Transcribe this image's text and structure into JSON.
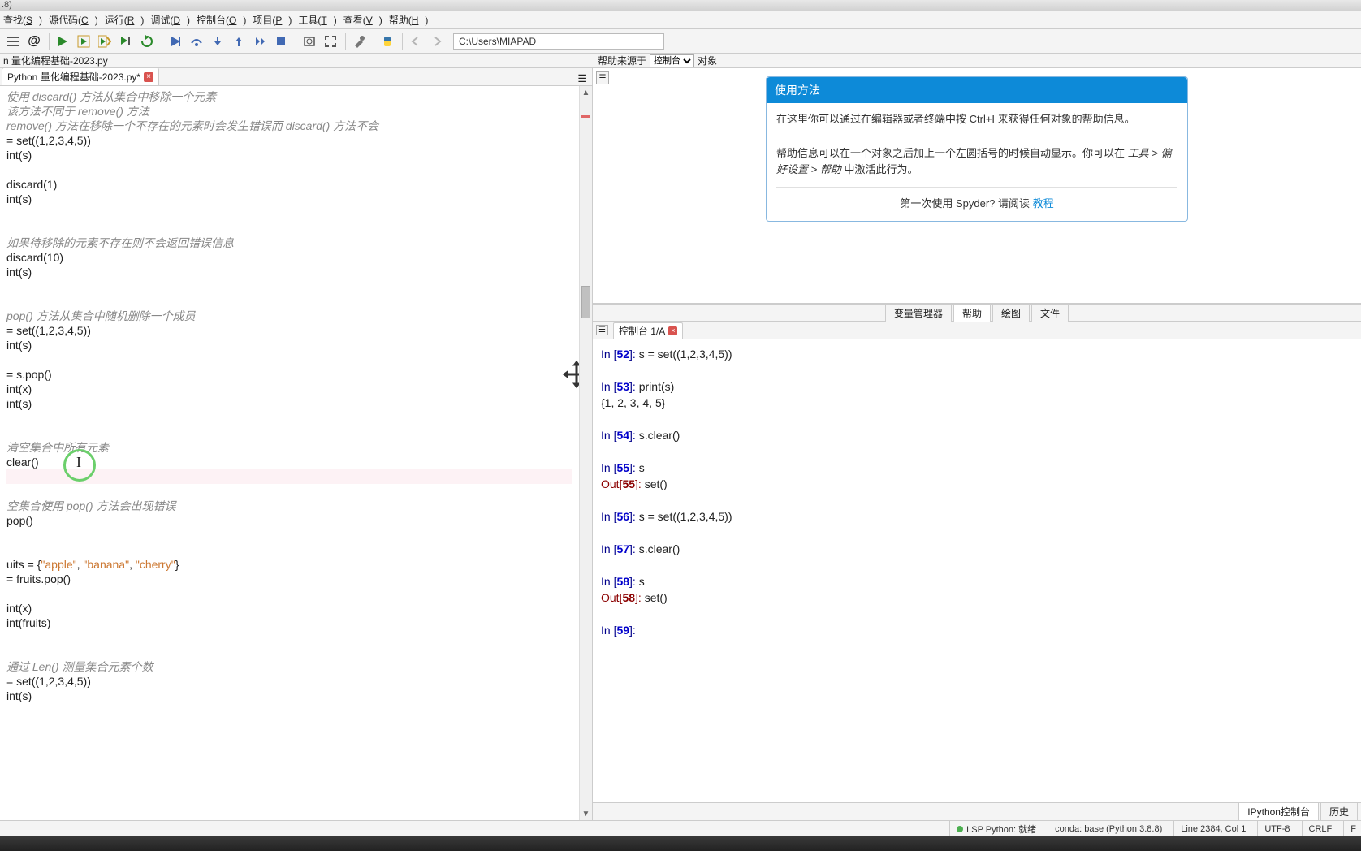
{
  "titlebar": ".8)",
  "menus": [
    "查找(S)",
    "源代码(C)",
    "运行(R)",
    "调试(D)",
    "控制台(O)",
    "项目(P)",
    "工具(T)",
    "查看(V)",
    "帮助(H)"
  ],
  "path": "C:\\Users\\MIAPAD",
  "filerow_left": "n 量化编程基础-2023.py",
  "filerow_right_label": "帮助来源于",
  "filerow_right_select": "控制台",
  "filerow_right_object": "对象",
  "tab_label": "Python 量化编程基础-2023.py*",
  "editor_lines": [
    {
      "t": "使用 discard() 方法从集合中移除一个元素",
      "cls": "comment"
    },
    {
      "t": "该方法不同于 remove() 方法",
      "cls": "comment"
    },
    {
      "t": "remove() 方法在移除一个不存在的元素时会发生错误而 discard() 方法不会",
      "cls": "comment"
    },
    {
      "t": "= set((1,2,3,4,5))",
      "cls": ""
    },
    {
      "t": "int(s)",
      "cls": ""
    },
    {
      "t": "",
      "cls": ""
    },
    {
      "t": "discard(1)",
      "cls": ""
    },
    {
      "t": "int(s)",
      "cls": ""
    },
    {
      "t": "",
      "cls": ""
    },
    {
      "t": "",
      "cls": ""
    },
    {
      "t": "如果待移除的元素不存在则不会返回错误信息",
      "cls": "comment"
    },
    {
      "t": "discard(10)",
      "cls": ""
    },
    {
      "t": "int(s)",
      "cls": ""
    },
    {
      "t": "",
      "cls": ""
    },
    {
      "t": "",
      "cls": ""
    },
    {
      "t": "pop() 方法从集合中随机删除一个成员",
      "cls": "comment"
    },
    {
      "t": "= set((1,2,3,4,5))",
      "cls": ""
    },
    {
      "t": "int(s)",
      "cls": ""
    },
    {
      "t": "",
      "cls": ""
    },
    {
      "t": "= s.pop()",
      "cls": ""
    },
    {
      "t": "int(x)",
      "cls": ""
    },
    {
      "t": "int(s)",
      "cls": ""
    },
    {
      "t": "",
      "cls": ""
    },
    {
      "t": "",
      "cls": ""
    },
    {
      "t": "清空集合中所有元素",
      "cls": "comment"
    },
    {
      "t": "clear()",
      "cls": ""
    },
    {
      "t": "",
      "cls": "hl"
    },
    {
      "t": "",
      "cls": ""
    },
    {
      "t": "空集合使用 pop() 方法会出现错误",
      "cls": "comment"
    },
    {
      "t": "pop()",
      "cls": ""
    },
    {
      "t": "",
      "cls": ""
    },
    {
      "t": "",
      "cls": ""
    },
    {
      "t": "uits = {\"apple\", \"banana\", \"cherry\"}",
      "cls": "str"
    },
    {
      "t": "= fruits.pop()",
      "cls": ""
    },
    {
      "t": "",
      "cls": ""
    },
    {
      "t": "int(x)",
      "cls": ""
    },
    {
      "t": "int(fruits)",
      "cls": ""
    },
    {
      "t": "",
      "cls": ""
    },
    {
      "t": "",
      "cls": ""
    },
    {
      "t": "通过 Len() 测量集合元素个数",
      "cls": "comment"
    },
    {
      "t": "= set((1,2,3,4,5))",
      "cls": ""
    },
    {
      "t": "int(s)",
      "cls": ""
    }
  ],
  "help": {
    "title": "使用方法",
    "p1a": "在这里你可以通过在编辑器或者终端中按 ",
    "p1key": "Ctrl+I",
    "p1b": " 来获得任何对象的帮助信息。",
    "p2a": "帮助信息可以在一个对象之后加上一个左圆括号的时候自动显示。你可以在 ",
    "p2it": "工具 > 偏好设置 > 帮助",
    "p2b": " 中激活此行为。",
    "p3a": "第一次使用 Spyder? 请阅读 ",
    "p3link": "教程"
  },
  "right_tabs": [
    "变量管理器",
    "帮助",
    "绘图",
    "文件"
  ],
  "right_tabs_active": 1,
  "console_tab": "控制台 1/A",
  "console_lines": [
    {
      "type": "in",
      "n": "52",
      "code": "s = set((1,2,3,4,5))"
    },
    {
      "type": "blank"
    },
    {
      "type": "in",
      "n": "53",
      "code": "print(s)"
    },
    {
      "type": "plain",
      "code": "{1, 2, 3, 4, 5}"
    },
    {
      "type": "blank"
    },
    {
      "type": "in",
      "n": "54",
      "code": "s.clear()"
    },
    {
      "type": "blank"
    },
    {
      "type": "in",
      "n": "55",
      "code": "s"
    },
    {
      "type": "out",
      "n": "55",
      "code": "set()"
    },
    {
      "type": "blank"
    },
    {
      "type": "in",
      "n": "56",
      "code": "s = set((1,2,3,4,5))"
    },
    {
      "type": "blank"
    },
    {
      "type": "in",
      "n": "57",
      "code": "s.clear()"
    },
    {
      "type": "blank"
    },
    {
      "type": "in",
      "n": "58",
      "code": "s"
    },
    {
      "type": "out",
      "n": "58",
      "code": "set()"
    },
    {
      "type": "blank"
    },
    {
      "type": "in",
      "n": "59",
      "code": ""
    }
  ],
  "console_foot": [
    "IPython控制台",
    "历史"
  ],
  "status": {
    "lsp": "LSP Python: 就绪",
    "conda": "conda: base (Python 3.8.8)",
    "linecol": "Line 2384, Col 1",
    "enc": "UTF-8",
    "eol": "CRLF",
    "rw": "F"
  }
}
